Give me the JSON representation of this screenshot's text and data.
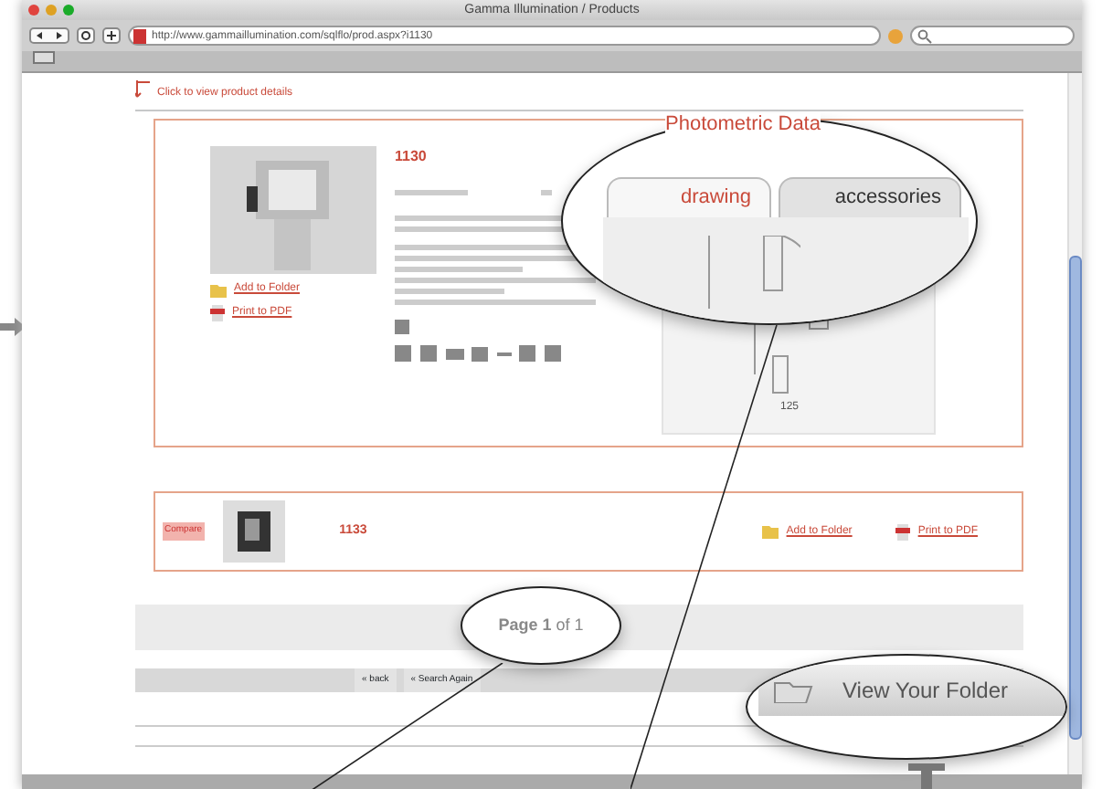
{
  "window": {
    "title": "Gamma Illumination / Products"
  },
  "toolbar": {
    "url": "http://www.gammaillumination.com/sqlflo/prod.aspx?i1130"
  },
  "page": {
    "hint": "Click to view product details",
    "product": {
      "code": "1130",
      "links": [
        "Add to Folder",
        "Print to PDF"
      ]
    },
    "compare_row": {
      "badge": "Compare",
      "code": "1133",
      "links": [
        "Add to Folder",
        "Print to PDF"
      ]
    },
    "nav_buttons": [
      "« back",
      "« Search Again"
    ]
  },
  "callouts": {
    "heading": "Photometric Data",
    "tabs": [
      {
        "label": "drawing",
        "selected": true
      },
      {
        "label": "accessories",
        "selected": false
      }
    ],
    "dimension": "125",
    "pagination": "**Page 1** of 1",
    "folder_button": "View Your Folder"
  }
}
